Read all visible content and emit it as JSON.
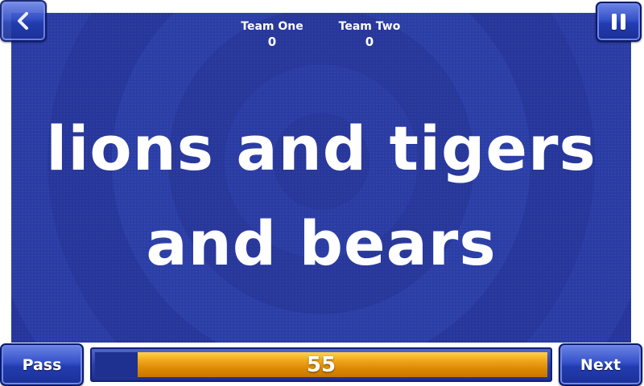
{
  "scoreboard": {
    "teams": [
      {
        "name": "Team One",
        "score": "0"
      },
      {
        "name": "Team Two",
        "score": "0"
      }
    ]
  },
  "phrase": {
    "line1": "lions and tigers",
    "line2": "and bears"
  },
  "controls": {
    "back_icon": "chevron-left-icon",
    "pause_icon": "pause-icon",
    "pass_label": "Pass",
    "next_label": "Next"
  },
  "timer": {
    "value": "55",
    "remaining_fraction": 0.905
  },
  "colors": {
    "background": "#27379a",
    "button": "#2a44bb",
    "timer_fill": "#e59a10",
    "text": "#ffffff"
  }
}
